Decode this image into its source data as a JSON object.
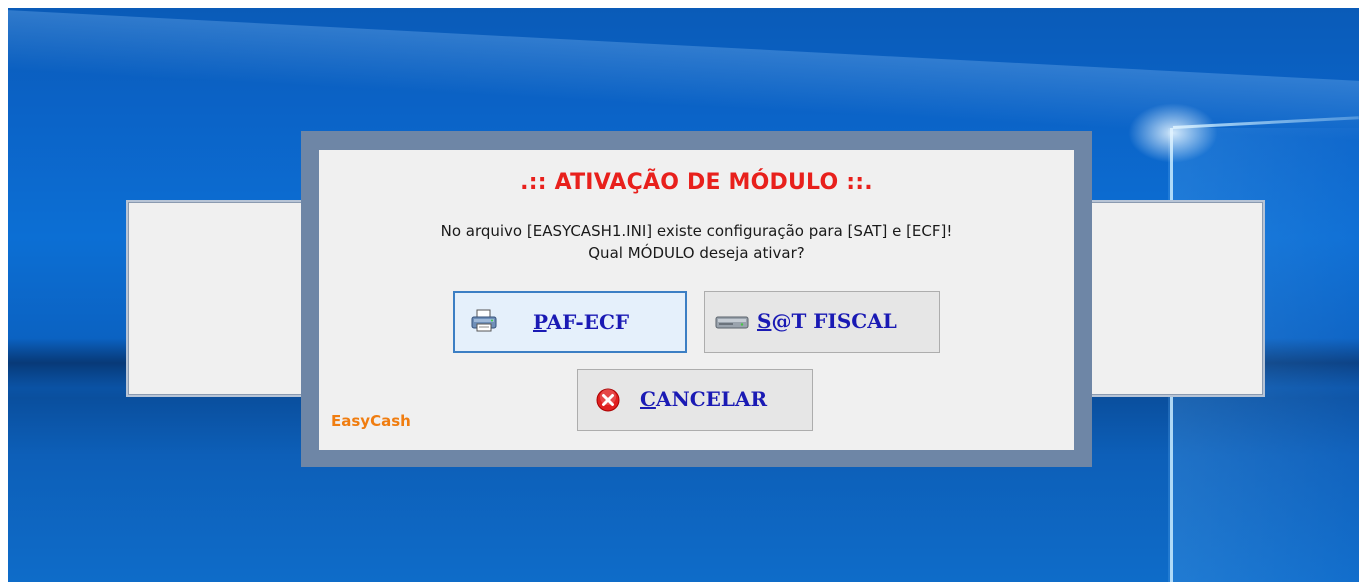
{
  "dialog": {
    "title": ".:: ATIVAÇÃO DE MÓDULO ::.",
    "message_line1": "No arquivo [EASYCASH1.INI] existe configuração para [SAT] e [ECF]!",
    "message_line2": "Qual MÓDULO deseja ativar?",
    "brand": "EasyCash"
  },
  "buttons": {
    "paf": {
      "hotkey": "P",
      "rest": "AF-ECF",
      "icon": "printer-icon"
    },
    "sat": {
      "hotkey": "S",
      "rest": "@T FISCAL",
      "icon": "sat-device-icon"
    },
    "cancel": {
      "hotkey": "C",
      "rest": "ANCELAR",
      "icon": "cancel-icon"
    }
  },
  "colors": {
    "title": "#e8201c",
    "button_label": "#1a1ab4",
    "brand": "#f07d10",
    "dialog_frame": "#6e86a6",
    "dialog_bg": "#f0f0f0"
  }
}
